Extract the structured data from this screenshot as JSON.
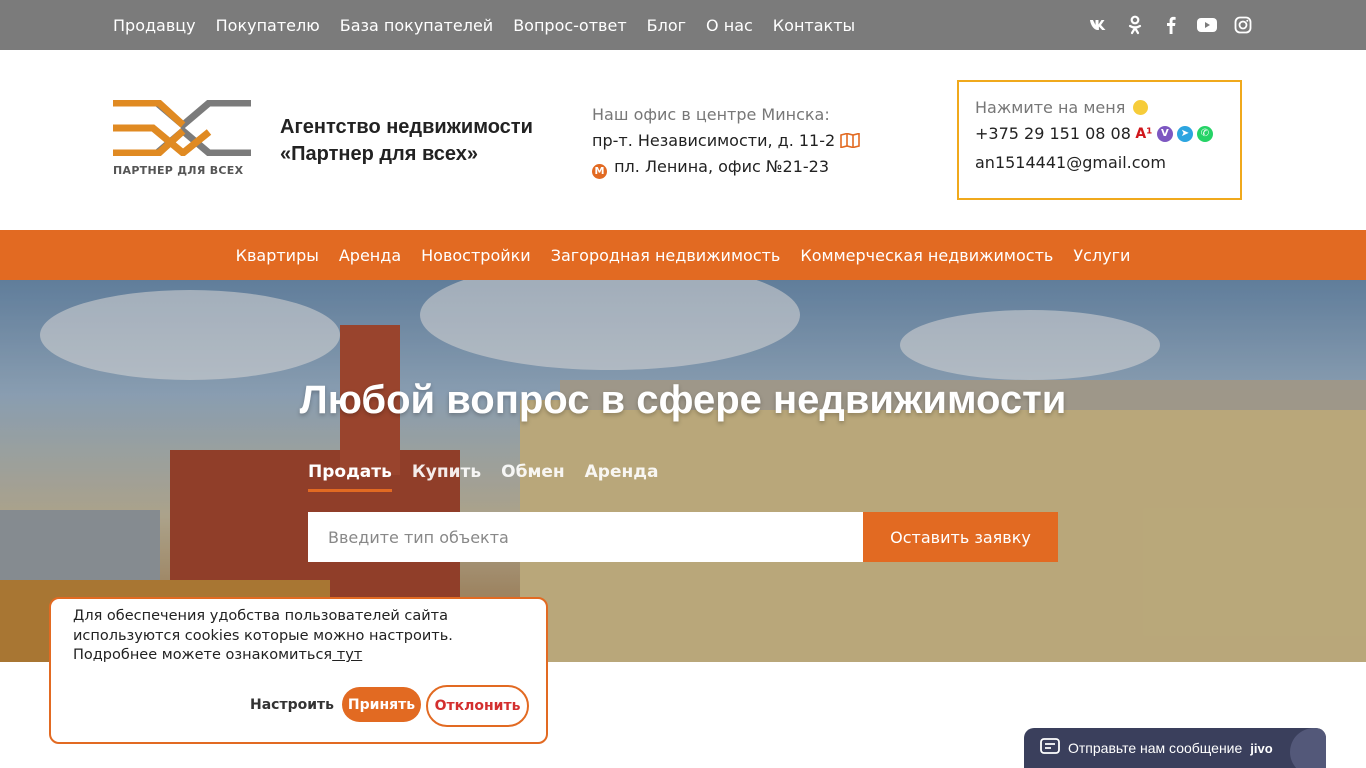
{
  "topbar": {
    "links": [
      "Продавцу",
      "Покупателю",
      "База покупателей",
      "Вопрос-ответ",
      "Блог",
      "О нас",
      "Контакты"
    ],
    "social": [
      "vk-icon",
      "odnoklassniki-icon",
      "facebook-icon",
      "youtube-icon",
      "instagram-icon"
    ]
  },
  "header": {
    "logo_text": "ПАРТНЕР ДЛЯ ВСЕХ",
    "agency_line1": "Агентство недвижимости",
    "agency_line2": "«Партнер для всех»",
    "office_title": "Наш офис в центре Минска:",
    "office_address": "пр-т. Независимости, д. 11-2",
    "office_metro": "пл. Ленина, офис №21-23",
    "metro_letter": "M",
    "contact_hint": "Нажмите на меня",
    "phone": "+375 29 151 08 08",
    "email": "an1514441@gmail.com"
  },
  "mainnav": {
    "links": [
      "Квартиры",
      "Аренда",
      "Новостройки",
      "Загородная недвижимость",
      "Коммерческая недвижимость",
      "Услуги"
    ]
  },
  "hero": {
    "title": "Любой вопрос в сфере недвижимости",
    "tabs": [
      "Продать",
      "Купить",
      "Обмен",
      "Аренда"
    ],
    "active_tab": "Продать",
    "search_placeholder": "Введите тип объекта",
    "submit_label": "Оставить заявку"
  },
  "cookie": {
    "text": "Для обеспечения удобства пользователей сайта используются cookies которые можно настроить. Подробнее можете ознакомиться",
    "link_text": " тут",
    "configure_label": "Настроить",
    "accept_label": "Принять",
    "decline_label": "Отклонить"
  },
  "chat": {
    "label": "Отправьте нам сообщение",
    "brand": "jivo"
  },
  "colors": {
    "accent": "#e26a22",
    "topbar": "#7b7b7b",
    "contact_border": "#f0a91c"
  }
}
